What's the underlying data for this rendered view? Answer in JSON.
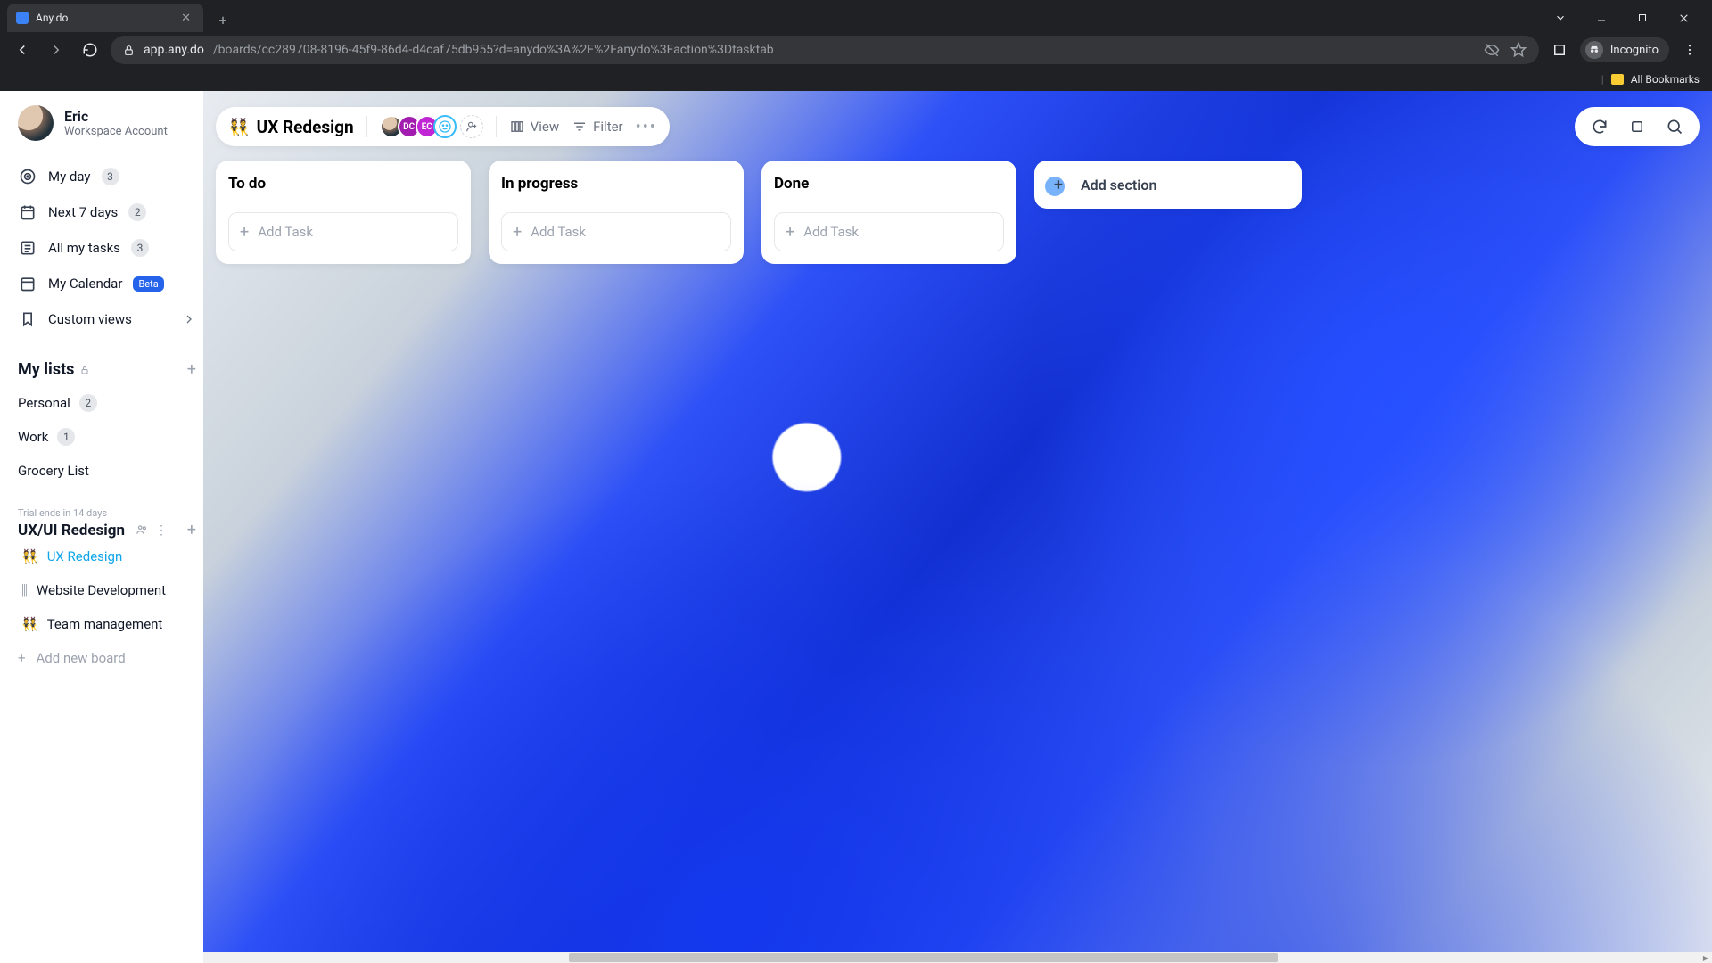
{
  "browser": {
    "tab_title": "Any.do",
    "url_host": "app.any.do",
    "url_path": "/boards/cc289708-8196-45f9-86d4-d4caf75db955?d=anydo%3A%2F%2Fanydo%3Faction%3Dtasktab",
    "incognito_label": "Incognito",
    "bookmarks_label": "All Bookmarks"
  },
  "user": {
    "name": "Eric",
    "subtitle": "Workspace Account"
  },
  "nav": {
    "my_day": {
      "label": "My day",
      "count": "3"
    },
    "next7": {
      "label": "Next 7 days",
      "count": "2"
    },
    "all_tasks": {
      "label": "All my tasks",
      "count": "3"
    },
    "calendar": {
      "label": "My Calendar",
      "badge": "Beta"
    },
    "custom_views": {
      "label": "Custom views"
    }
  },
  "my_lists": {
    "heading": "My lists",
    "items": [
      {
        "label": "Personal",
        "count": "2"
      },
      {
        "label": "Work",
        "count": "1"
      },
      {
        "label": "Grocery List"
      }
    ]
  },
  "workspace": {
    "trial": "Trial ends in 14 days",
    "name": "UX/UI Redesign",
    "boards": [
      {
        "emoji": "👯",
        "label": "UX Redesign",
        "active": true
      },
      {
        "emoji": "⫼",
        "label": "Website Development"
      },
      {
        "emoji": "👯",
        "label": "Team management"
      }
    ],
    "add_board": "Add new board"
  },
  "board": {
    "emoji": "👯",
    "title": "UX Redesign",
    "avatars": {
      "dc": "DC",
      "ec": "EC"
    },
    "view_label": "View",
    "filter_label": "Filter",
    "add_task_label": "Add Task",
    "columns": [
      {
        "title": "To do"
      },
      {
        "title": "In progress"
      },
      {
        "title": "Done"
      }
    ],
    "add_section_label": "Add section"
  }
}
